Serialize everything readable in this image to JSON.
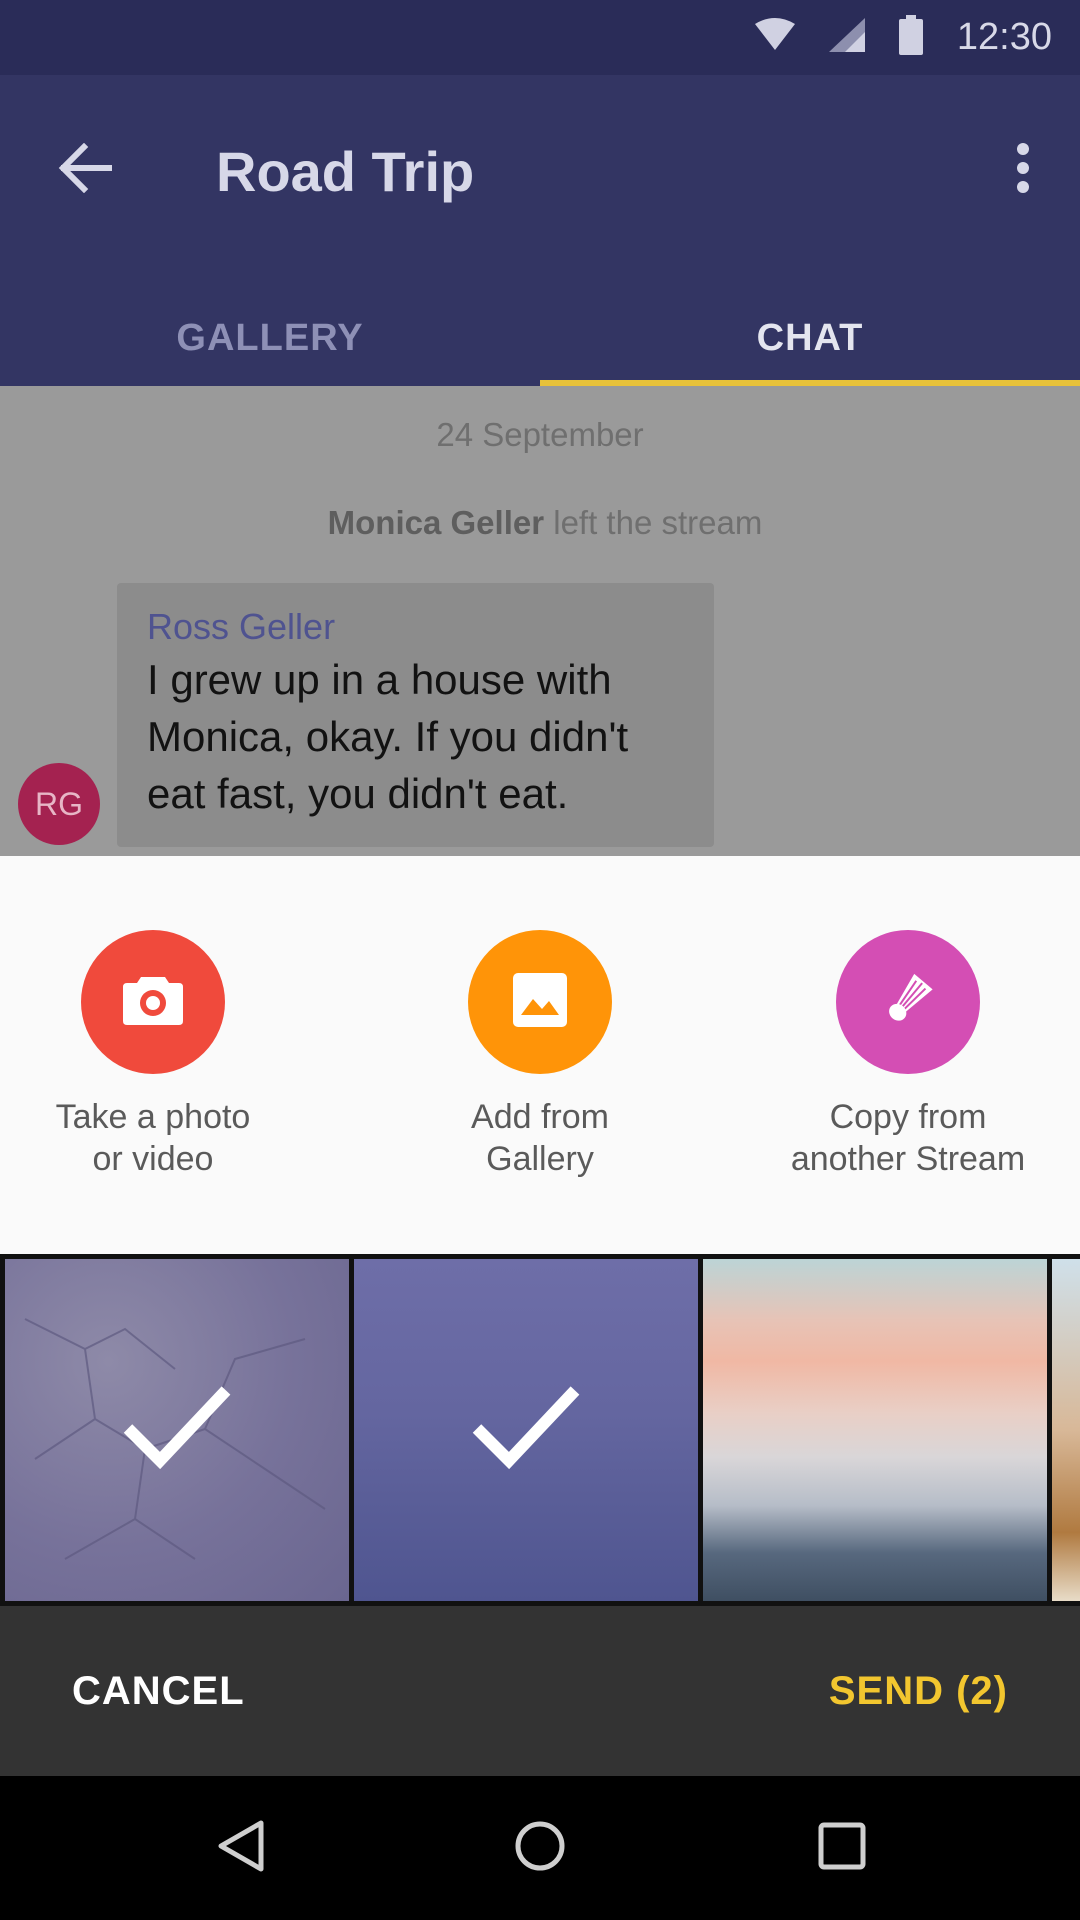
{
  "status_bar": {
    "time": "12:30",
    "icons": [
      "wifi-icon",
      "signal-icon",
      "battery-icon"
    ]
  },
  "app_bar": {
    "title": "Road Trip",
    "back_icon": "arrow-back-icon",
    "menu_icon": "more-vert-icon"
  },
  "tabs": [
    {
      "label": "GALLERY",
      "active": false
    },
    {
      "label": "CHAT",
      "active": true
    }
  ],
  "chat": {
    "date": "24 September",
    "event": {
      "name": "Monica Geller",
      "text": "left the stream"
    },
    "message": {
      "sender": "Ross Geller",
      "text": "I grew up in a house with Monica, okay. If you didn't eat fast, you didn't eat.",
      "avatar_initials": "RG"
    }
  },
  "sheet": {
    "actions": [
      {
        "label": "Take a photo\nor video",
        "icon": "camera-icon",
        "color": "#f04a3c"
      },
      {
        "label": "Add from\nGallery",
        "icon": "image-icon",
        "color": "#ff9408"
      },
      {
        "label": "Copy from\nanother Stream",
        "icon": "shuttlecock-icon",
        "color": "#d44eb4"
      }
    ],
    "thumbnails": [
      {
        "name": "cracked-ground-photo",
        "selected": true
      },
      {
        "name": "misty-sea-photo",
        "selected": true
      },
      {
        "name": "sunset-sea-photo",
        "selected": false
      },
      {
        "name": "partial-photo",
        "selected": false
      }
    ]
  },
  "action_bar": {
    "cancel": "CANCEL",
    "send": "SEND (2)"
  },
  "nav_bar": {
    "icons": [
      "back-triangle-icon",
      "home-circle-icon",
      "recents-square-icon"
    ]
  },
  "colors": {
    "primary": "#333563",
    "status_bar": "#2a2c58",
    "accent": "#e8c23a",
    "send": "#f2c62f"
  }
}
